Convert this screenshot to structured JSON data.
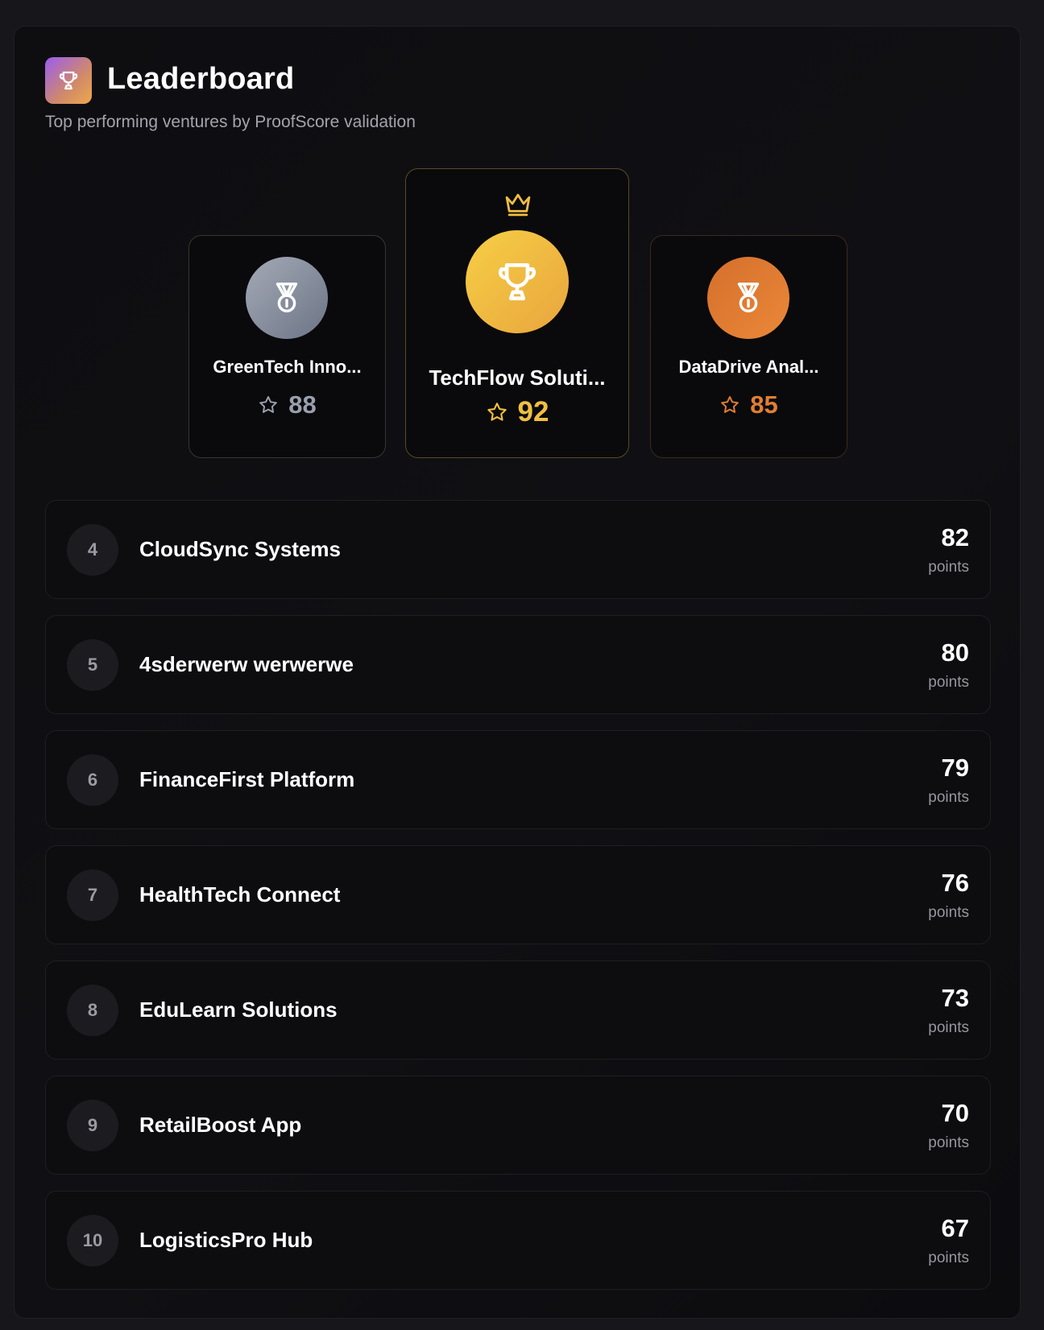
{
  "header": {
    "title": "Leaderboard",
    "subtitle": "Top performing ventures by ProofScore validation",
    "logo_icon": "trophy-icon"
  },
  "podium": {
    "first": {
      "rank": 1,
      "name": "TechFlow Soluti...",
      "score": "92",
      "icon": "trophy-icon",
      "accent": "#f0bf41"
    },
    "second": {
      "rank": 2,
      "name": "GreenTech Inno...",
      "score": "88",
      "icon": "medal-icon",
      "accent": "#9aa0ad"
    },
    "third": {
      "rank": 3,
      "name": "DataDrive Anal...",
      "score": "85",
      "icon": "medal-icon",
      "accent": "#e07f34"
    }
  },
  "rankings": [
    {
      "rank": "4",
      "name": "CloudSync Systems",
      "points": "82",
      "points_label": "points"
    },
    {
      "rank": "5",
      "name": "4sderwerw werwerwe",
      "points": "80",
      "points_label": "points"
    },
    {
      "rank": "6",
      "name": "FinanceFirst Platform",
      "points": "79",
      "points_label": "points"
    },
    {
      "rank": "7",
      "name": "HealthTech Connect",
      "points": "76",
      "points_label": "points"
    },
    {
      "rank": "8",
      "name": "EduLearn Solutions",
      "points": "73",
      "points_label": "points"
    },
    {
      "rank": "9",
      "name": "RetailBoost App",
      "points": "70",
      "points_label": "points"
    },
    {
      "rank": "10",
      "name": "LogisticsPro Hub",
      "points": "67",
      "points_label": "points"
    }
  ]
}
